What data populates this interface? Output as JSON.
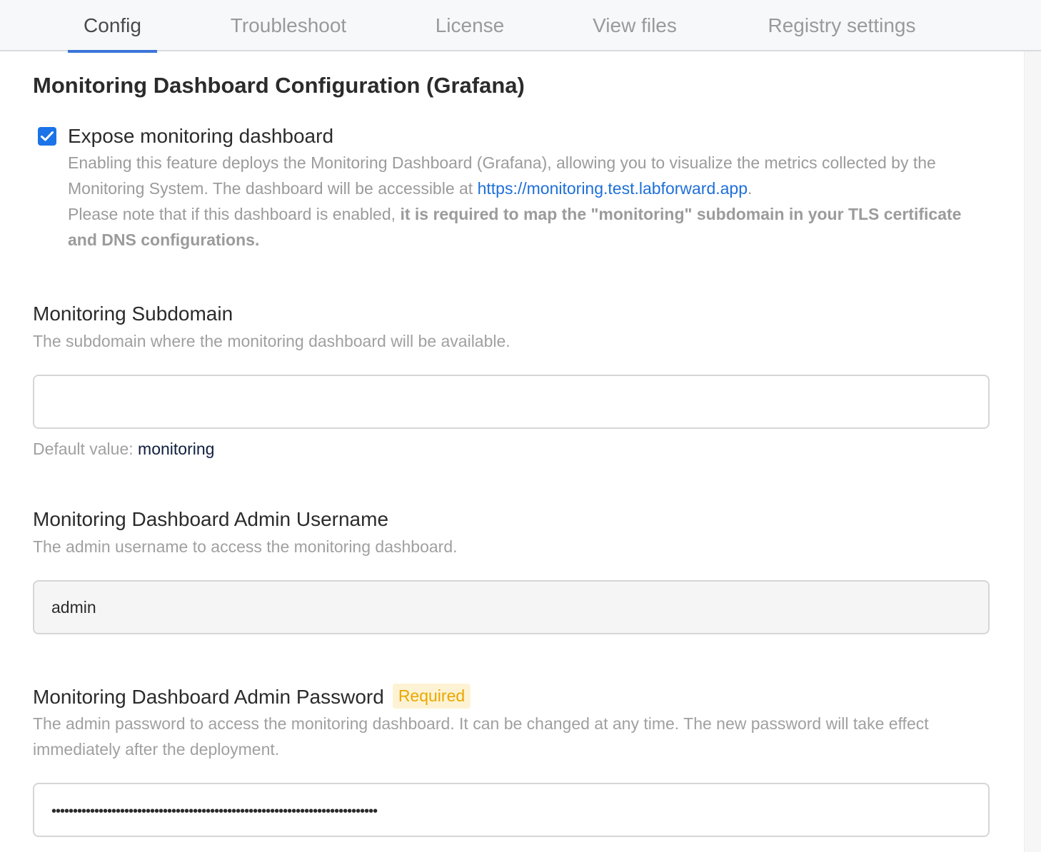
{
  "tabs": [
    {
      "label": "Config",
      "active": true
    },
    {
      "label": "Troubleshoot",
      "active": false
    },
    {
      "label": "License",
      "active": false
    },
    {
      "label": "View files",
      "active": false
    },
    {
      "label": "Registry settings",
      "active": false
    }
  ],
  "section": {
    "title": "Monitoring Dashboard Configuration (Grafana)"
  },
  "expose": {
    "label": "Expose monitoring dashboard",
    "checked": true,
    "help_part1": "Enabling this feature deploys the Monitoring Dashboard (Grafana), allowing you to visualize the metrics collected by the Monitoring System. The dashboard will be accessible at ",
    "link": "https://monitoring.test.labforward.app",
    "help_part2": ".",
    "note_plain": "Please note that if this dashboard is enabled, ",
    "note_bold": "it is required to map the \"monitoring\" subdomain in your TLS certificate and DNS configurations."
  },
  "subdomain": {
    "label": "Monitoring Subdomain",
    "description": "The subdomain where the monitoring dashboard will be available.",
    "value": "",
    "default_prefix": "Default value:",
    "default_value": "monitoring"
  },
  "username": {
    "label": "Monitoring Dashboard Admin Username",
    "description": "The admin username to access the monitoring dashboard.",
    "value": "admin"
  },
  "password": {
    "label": "Monitoring Dashboard Admin Password",
    "badge": "Required",
    "description": "The admin password to access the monitoring dashboard. It can be changed at any time. The new password will take effect immediately after the deployment.",
    "masked_value": "••••••••••••••••••••••••••••••••••••••••••••••••••••••••••••••••••••••••••••"
  },
  "colors": {
    "accent": "#1a73e8",
    "tab_underline": "#3a74d8",
    "link": "#1e6fd9",
    "badge_bg": "#fdf3d4",
    "badge_text": "#eaa700"
  }
}
